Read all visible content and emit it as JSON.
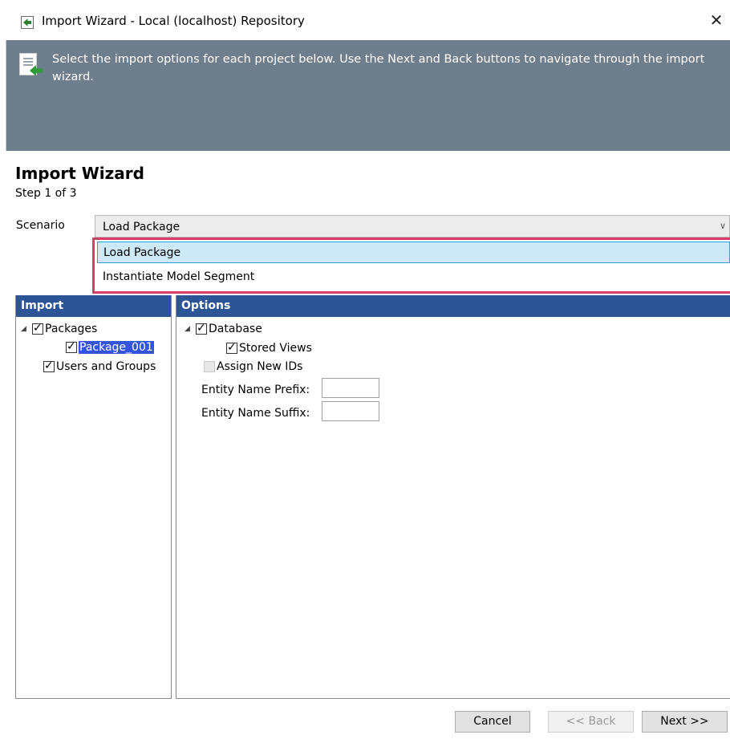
{
  "window": {
    "title": "Import Wizard - Local  (localhost) Repository",
    "close_glyph": "✕"
  },
  "banner": {
    "text": "Select the import options for each project below. Use the Next and Back buttons to navigate through the import wizard.",
    "icon": "document-import-icon"
  },
  "header": {
    "title": "Import Wizard",
    "step": "Step 1 of 3"
  },
  "scenario": {
    "label": "Scenario",
    "value": "Load Package",
    "options": [
      "Load Package",
      "Instantiate Model Segment"
    ],
    "highlight_color": "#dd3a6a"
  },
  "import_panel": {
    "header": "Import",
    "items": [
      {
        "label": "Packages",
        "checked": true
      },
      {
        "label": "Package_001",
        "checked": true,
        "selected": true
      },
      {
        "label": "Users and Groups",
        "checked": true
      }
    ]
  },
  "options_panel": {
    "header": "Options",
    "items": [
      {
        "label": "Database",
        "checked": true
      },
      {
        "label": "Stored Views",
        "checked": true
      },
      {
        "label": "Assign New IDs",
        "checked": false,
        "disabled": true
      }
    ],
    "prefix_label": "Entity Name Prefix:",
    "prefix_value": "",
    "suffix_label": "Entity Name Suffix:",
    "suffix_value": ""
  },
  "buttons": {
    "cancel": "Cancel",
    "back": "<< Back",
    "next": "Next >>"
  },
  "colors": {
    "banner": "#6f7e8c",
    "panel_header": "#2c5597",
    "selection": "#3355dd"
  }
}
